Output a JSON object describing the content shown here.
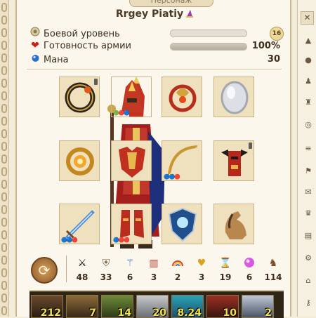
{
  "panel": {
    "tab_label": "Персонаж",
    "player_name": "Rrgey Piatiy"
  },
  "stats": [
    {
      "icon": "laurel-icon",
      "label": "Боевой уровень",
      "bar": 0.0,
      "value": "16"
    },
    {
      "icon": "heart-icon",
      "label": "Готовность армии",
      "bar": 1.0,
      "value": "100%"
    },
    {
      "icon": "mana-icon",
      "label": "Мана",
      "value": "30"
    }
  ],
  "equipment": [
    {
      "name": "ring-slot-1",
      "item": "dark-ring"
    },
    {
      "name": "helmet-slot",
      "item": "golden-helmet"
    },
    {
      "name": "amulet-slot",
      "item": "dragon-amulet"
    },
    {
      "name": "mirror-slot",
      "item": "silver-mirror"
    },
    {
      "name": "ring-slot-2",
      "item": "sun-ring"
    },
    {
      "name": "armor-slot",
      "item": "red-armor"
    },
    {
      "name": "bow-slot",
      "item": "golden-bow"
    },
    {
      "name": "totem-slot",
      "item": "totem"
    },
    {
      "name": "weapon-slot",
      "item": "ice-sword"
    },
    {
      "name": "boots-slot",
      "item": "red-boots"
    },
    {
      "name": "shield-slot",
      "item": "ice-shield"
    },
    {
      "name": "horse-slot",
      "item": "horse"
    }
  ],
  "attributes": [
    {
      "name": "attack",
      "icon": "crossed-swords-icon",
      "value": "48"
    },
    {
      "name": "defense",
      "icon": "shield-icon",
      "value": "33"
    },
    {
      "name": "spellpower",
      "icon": "wand-icon",
      "value": "6"
    },
    {
      "name": "knowledge",
      "icon": "book-icon",
      "value": "3"
    },
    {
      "name": "luck",
      "icon": "rainbow-icon",
      "value": "2"
    },
    {
      "name": "morale",
      "icon": "wings-icon",
      "value": "3"
    },
    {
      "name": "initiative",
      "icon": "hourglass-icon",
      "value": "19"
    },
    {
      "name": "mana-crystal",
      "icon": "orb-icon",
      "value": "6"
    },
    {
      "name": "army",
      "icon": "soldier-icon",
      "value": "114"
    }
  ],
  "creatures": [
    "212",
    "7",
    "14",
    "20",
    "8.24",
    "10",
    "2"
  ],
  "colors": {
    "panel": "#fbf7ec",
    "border": "#c7b690",
    "gold": "#f2e34a"
  }
}
